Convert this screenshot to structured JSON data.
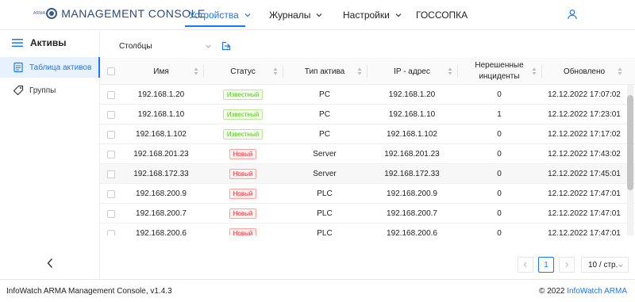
{
  "app": {
    "logo_small": "ARMA",
    "logo_text": "MANAGEMENT CONSOLE"
  },
  "nav": {
    "items": [
      {
        "label": "Устройства",
        "active": true
      },
      {
        "label": "Журналы"
      },
      {
        "label": "Настройки"
      },
      {
        "label": "ГОССОПКА"
      }
    ]
  },
  "sidebar": {
    "title": "Активы",
    "items": [
      {
        "label": "Таблица активов",
        "active": true,
        "icon": "table-icon"
      },
      {
        "label": "Группы",
        "icon": "tag-icon"
      }
    ]
  },
  "toolbar": {
    "columns_label": "Столбцы"
  },
  "table": {
    "headers": [
      "Имя",
      "Статус",
      "Тип актива",
      "IP - адрес",
      "Нерешенные инциденты",
      "Обновлено"
    ],
    "rows": [
      {
        "name": "192.168.1.20",
        "status": "Известный",
        "status_kind": "known",
        "type": "PC",
        "ip": "192.168.1.20",
        "incidents": "0",
        "updated": "12.12.2022 17:07:02"
      },
      {
        "name": "192.168.1.10",
        "status": "Известный",
        "status_kind": "known",
        "type": "PC",
        "ip": "192.168.1.10",
        "incidents": "1",
        "updated": "12.12.2022 17:23:01"
      },
      {
        "name": "192.168.1.102",
        "status": "Известный",
        "status_kind": "known",
        "type": "PC",
        "ip": "192.168.1.102",
        "incidents": "0",
        "updated": "12.12.2022 17:17:02"
      },
      {
        "name": "192.168.201.23",
        "status": "Новый",
        "status_kind": "new",
        "type": "Server",
        "ip": "192.168.201.23",
        "incidents": "0",
        "updated": "12.12.2022 17:43:02"
      },
      {
        "name": "192.168.172.33",
        "status": "Новый",
        "status_kind": "new",
        "type": "Server",
        "ip": "192.168.172.33",
        "incidents": "0",
        "updated": "12.12.2022 17:45:01"
      },
      {
        "name": "192.168.200.9",
        "status": "Новый",
        "status_kind": "new",
        "type": "PLC",
        "ip": "192.168.200.9",
        "incidents": "0",
        "updated": "12.12.2022 17:47:01"
      },
      {
        "name": "192.168.200.7",
        "status": "Новый",
        "status_kind": "new",
        "type": "PLC",
        "ip": "192.168.200.7",
        "incidents": "0",
        "updated": "12.12.2022 17:47:01"
      },
      {
        "name": "192.168.200.6",
        "status": "Новый",
        "status_kind": "new",
        "type": "PLC",
        "ip": "192.168.200.6",
        "incidents": "0",
        "updated": "12.12.2022 17:47:01"
      }
    ]
  },
  "pagination": {
    "current_page": "1",
    "page_size": "10 / стр."
  },
  "footer": {
    "left": "InfoWatch ARMA Management Console, v1.4.3",
    "copyright": "© 2022 ",
    "link": "InfoWatch ARMA"
  },
  "colors": {
    "accent": "#1677ff",
    "known": "#52c41a",
    "new": "#f5222d"
  }
}
